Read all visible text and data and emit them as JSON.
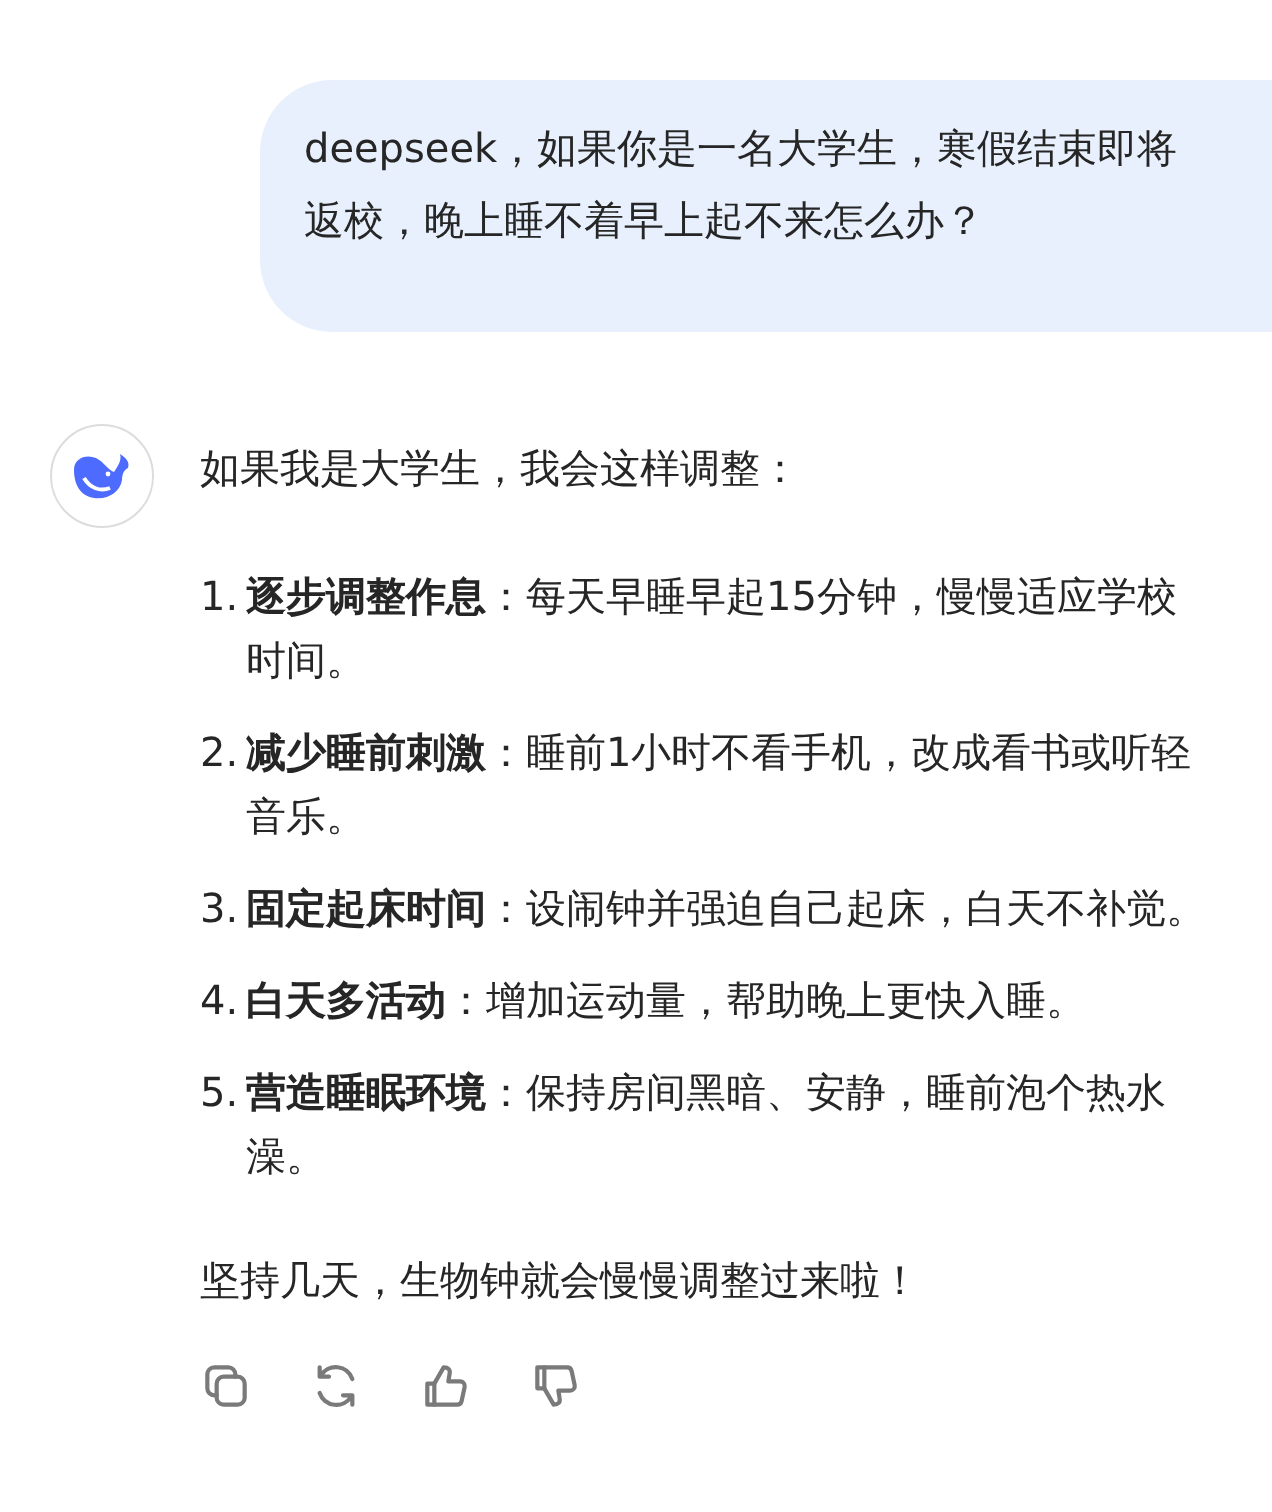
{
  "user_message": "deepseek，如果你是一名大学生，寒假结束即将返校，晚上睡不着早上起不来怎么办？",
  "reply": {
    "intro": "如果我是大学生，我会这样调整：",
    "items": [
      {
        "number": "1.",
        "title": "逐步调整作息",
        "text": "：每天早睡早起15分钟，慢慢适应学校时间。"
      },
      {
        "number": "2.",
        "title": "减少睡前刺激",
        "text": "：睡前1小时不看手机，改成看书或听轻音乐。"
      },
      {
        "number": "3.",
        "title": "固定起床时间",
        "text": "：设闹钟并强迫自己起床，白天不补觉。"
      },
      {
        "number": "4.",
        "title": "白天多活动",
        "text": "：增加运动量，帮助晚上更快入睡。"
      },
      {
        "number": "5.",
        "title": "营造睡眠环境",
        "text": "：保持房间黑暗、安静，睡前泡个热水澡。"
      }
    ],
    "closing": "坚持几天，生物钟就会慢慢调整过来啦！"
  }
}
